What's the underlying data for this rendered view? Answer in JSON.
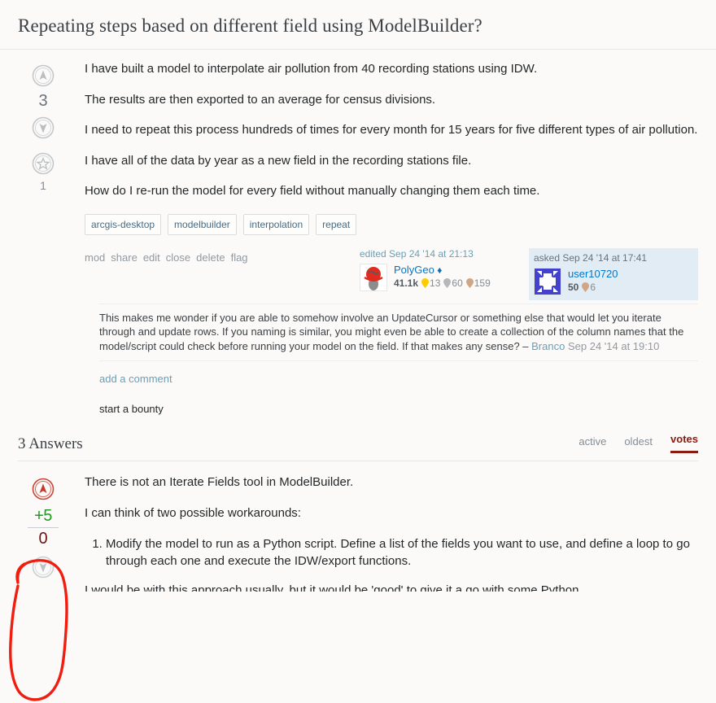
{
  "question": {
    "title": "Repeating steps based on different field using ModelBuilder?",
    "score": "3",
    "favorites": "1",
    "body": [
      "I have built a model to interpolate air pollution from 40 recording stations using IDW.",
      "The results are then exported to an average for census divisions.",
      "I need to repeat this process hundreds of times for every month for 15 years for five different types of air pollution.",
      "I have all of the data by year as a new field in the recording stations file.",
      "How do I re-run the model for every field without manually changing them each time."
    ],
    "tags": [
      "arcgis-desktop",
      "modelbuilder",
      "interpolation",
      "repeat"
    ],
    "menu": [
      "mod",
      "share",
      "edit",
      "close",
      "delete",
      "flag"
    ],
    "editor": {
      "action_time": "edited Sep 24 '14 at 21:13",
      "name": "PolyGeo",
      "diamond": "♦",
      "reputation": "41.1k",
      "gold": "13",
      "silver": "60",
      "bronze": "159"
    },
    "owner": {
      "action_time": "asked Sep 24 '14 at 17:41",
      "name": "user10720",
      "reputation": "50",
      "bronze": "6"
    },
    "comments": [
      {
        "text": "This makes me wonder if you are able to somehow involve an UpdateCursor or something else that would let you iterate through and update rows. If you naming is similar, you might even be able to create a collection of the column names that the model/script could check before running your model on the field. If that makes any sense? – ",
        "user": "Branco",
        "date": "Sep 24 '14 at 19:10"
      }
    ],
    "add_comment_label": "add a comment",
    "bounty_label": "start a bounty"
  },
  "answers_section": {
    "heading": "3 Answers",
    "sort_tabs": [
      {
        "label": "active",
        "selected": false
      },
      {
        "label": "oldest",
        "selected": false
      },
      {
        "label": "votes",
        "selected": true
      }
    ]
  },
  "answer": {
    "annotation_score_add": "+5",
    "annotation_score_zero": "0",
    "paragraphs": [
      "There is not an Iterate Fields tool in ModelBuilder.",
      "I can think of two possible workarounds:"
    ],
    "list_items": [
      "Modify the model to run as a Python script. Define a list of the fields you want to use, and define a loop to go through each one and execute the IDW/export functions."
    ],
    "clipped_line": "I would be with this approach usually, but it would be 'good' to give it a go with some Python"
  },
  "colors": {
    "page_bg": "#fbfaf8",
    "owner_card_bg": "#e1ecf4",
    "link": "#0077cc",
    "muted": "#848d95",
    "selected_tab": "#8b1a10",
    "annotation_red": "#f01e10",
    "gold_badge": "#ffcc01",
    "silver_badge": "#b4b8bc",
    "bronze_badge": "#d1a684",
    "plus_green": "#1d9b1d",
    "zero_darkred": "#6d1410"
  }
}
